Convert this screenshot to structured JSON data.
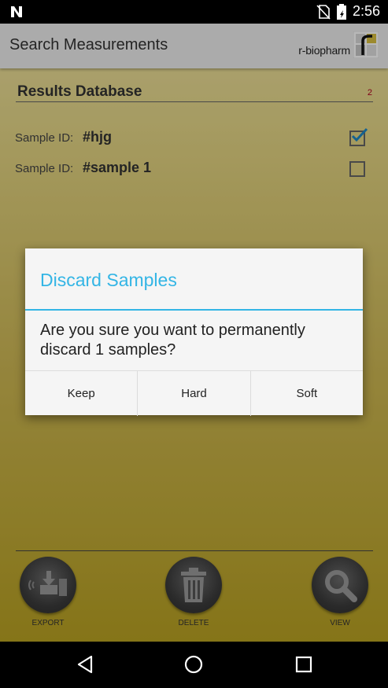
{
  "status_bar": {
    "time": "2:56",
    "icons": [
      "notification-n-icon",
      "no-sim-icon",
      "battery-icon"
    ]
  },
  "app_bar": {
    "title": "Search Measurements",
    "brand": "r-biopharm",
    "brand_logo": "r-biopharm-logo-icon"
  },
  "results": {
    "title": "Results Database",
    "count": "2",
    "items": [
      {
        "label": "Sample ID:",
        "value": "#hjg",
        "checked": true
      },
      {
        "label": "Sample ID:",
        "value": "#sample 1",
        "checked": false
      }
    ]
  },
  "actions": [
    {
      "label": "EXPORT",
      "icon": "export-icon"
    },
    {
      "label": "DELETE",
      "icon": "trash-icon"
    },
    {
      "label": "VIEW",
      "icon": "magnifier-icon"
    }
  ],
  "dialog": {
    "title": "Discard Samples",
    "message": "Are you sure you want to permanently discard 1  samples?",
    "buttons": [
      "Keep",
      "Hard",
      "Soft"
    ]
  },
  "nav": [
    "back-icon",
    "home-icon",
    "recents-icon"
  ],
  "colors": {
    "accent": "#33b5e5",
    "checkmark": "#1e88c8",
    "count": "#b00020"
  }
}
